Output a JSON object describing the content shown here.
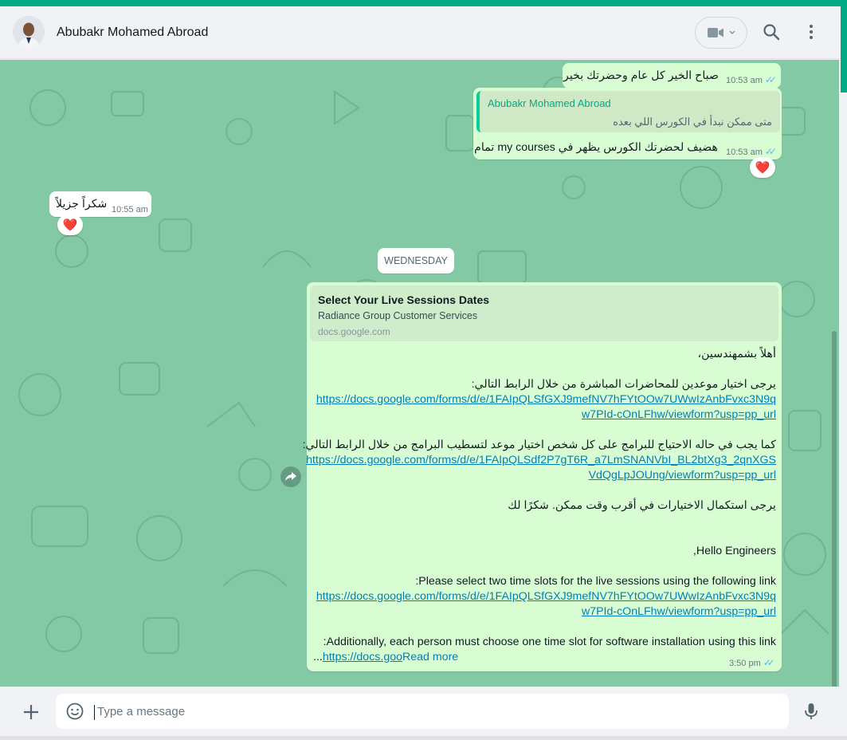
{
  "header": {
    "contact_name": "Abubakr Mohamed Abroad"
  },
  "messages": {
    "m1": {
      "text": "صباح الخير كل عام وحضرتك بخير",
      "time": "10:53 am"
    },
    "m2": {
      "quote_name": "Abubakr Mohamed Abroad",
      "quote_text": "متى ممكن نبدأ في الكورس اللي بعده",
      "text": "هضيف لحضرتك الكورس يظهر في my courses تمام",
      "time": "10:53 am",
      "reaction": "❤️"
    },
    "m3": {
      "text": "شكراً جزيلاً",
      "time": "10:55 am",
      "reaction": "❤️"
    },
    "date_divider": "WEDNESDAY",
    "m4": {
      "preview_title": "Select Your Live Sessions Dates",
      "preview_desc": "Radiance Group Customer Services",
      "preview_host": "docs.google.com",
      "greeting_ar": "أهلاً بشمهندسين،",
      "line_ar_1": "يرجى اختيار موعدين للمحاضرات المباشرة من خلال الرابط التالي:",
      "link_1a": "https://docs.google.com/forms/d/e/1FAIpQLSfGXJ9mefNV7hFYtOOw7UWwIzAnbFvxc3N9q",
      "link_1b": "w7PId-cOnLFhw/viewform?usp=pp_url",
      "line_ar_2": "كما يجب في حاله الاحتياج للبرامج على كل شخص اختيار موعد لتسطيب البرامج من خلال الرابط التالي:",
      "link_2a": "https://docs.google.com/forms/d/e/1FAIpQLSdf2P7gT6R_a7LmSNANVbI_BL2btXg3_2qnXGS",
      "link_2b": "VdQgLpJOUng/viewform?usp=pp_url",
      "line_ar_3": "يرجى استكمال الاختيارات في أقرب وقت ممكن. شكرًا لك",
      "greeting_en": ",Hello Engineers",
      "line_en_1": ":Please select two time slots for the live sessions using the following link",
      "link_3a": "https://docs.google.com/forms/d/e/1FAIpQLSfGXJ9mefNV7hFYtOOw7UWwIzAnbFvxc3N9q",
      "link_3b": "w7PId-cOnLFhw/viewform?usp=pp_url",
      "line_en_2": ":Additionally, each person must choose one time slot for software installation using this link",
      "last_prefix": "...",
      "last_link": "https://docs.goo",
      "read_more": "Read more",
      "time": "3:50 pm"
    }
  },
  "composer": {
    "placeholder": "Type a message"
  },
  "colors": {
    "accent": "#00a884",
    "outgoing_bubble": "#d9fdd3",
    "chat_background": "#84c9a6",
    "link": "#027eb5",
    "read_tick": "#53bdeb"
  },
  "icons": [
    "video-call-icon",
    "chevron-down-icon",
    "search-icon",
    "menu-icon",
    "heart-icon",
    "forward-icon",
    "plus-icon",
    "emoji-icon",
    "mic-icon",
    "double-check-icon"
  ]
}
